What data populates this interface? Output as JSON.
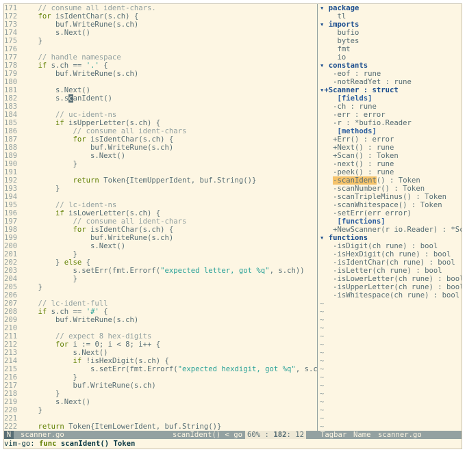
{
  "editor": {
    "lines": [
      {
        "n": "171",
        "segs": [
          [
            "cm",
            "    // consume all ident-chars."
          ]
        ]
      },
      {
        "n": "172",
        "segs": [
          [
            "",
            "    "
          ],
          [
            "kw",
            "for"
          ],
          [
            "",
            " isIdentChar(s.ch) {"
          ]
        ]
      },
      {
        "n": "173",
        "segs": [
          [
            "",
            "        buf.WriteRune(s.ch)"
          ]
        ]
      },
      {
        "n": "174",
        "segs": [
          [
            "",
            "        s.Next()"
          ]
        ]
      },
      {
        "n": "175",
        "segs": [
          [
            "",
            "    }"
          ]
        ]
      },
      {
        "n": "176",
        "segs": []
      },
      {
        "n": "177",
        "segs": [
          [
            "cm",
            "    // handle namespace"
          ]
        ]
      },
      {
        "n": "178",
        "segs": [
          [
            "",
            "    "
          ],
          [
            "kw",
            "if"
          ],
          [
            "",
            " s.ch == "
          ],
          [
            "st",
            "'.'"
          ],
          [
            "",
            " {"
          ]
        ]
      },
      {
        "n": "179",
        "segs": [
          [
            "",
            "        buf.WriteRune(s.ch)"
          ]
        ]
      },
      {
        "n": "180",
        "segs": []
      },
      {
        "n": "181",
        "segs": [
          [
            "",
            "        s.Next()"
          ]
        ]
      },
      {
        "n": "182",
        "segs": [
          [
            "",
            "        s.s"
          ],
          [
            "cursor",
            "c"
          ],
          [
            "",
            "anIdent()"
          ]
        ]
      },
      {
        "n": "183",
        "segs": []
      },
      {
        "n": "184",
        "segs": [
          [
            "cm",
            "        // uc-ident-ns"
          ]
        ]
      },
      {
        "n": "185",
        "segs": [
          [
            "",
            "        "
          ],
          [
            "kw",
            "if"
          ],
          [
            "",
            " isUpperLetter(s.ch) {"
          ]
        ]
      },
      {
        "n": "186",
        "segs": [
          [
            "cm",
            "            // consume all ident-chars"
          ]
        ]
      },
      {
        "n": "187",
        "segs": [
          [
            "",
            "            "
          ],
          [
            "kw",
            "for"
          ],
          [
            "",
            " isIdentChar(s.ch) {"
          ]
        ]
      },
      {
        "n": "188",
        "segs": [
          [
            "",
            "                buf.WriteRune(s.ch)"
          ]
        ]
      },
      {
        "n": "189",
        "segs": [
          [
            "",
            "                s.Next()"
          ]
        ]
      },
      {
        "n": "190",
        "segs": [
          [
            "",
            "            }"
          ]
        ]
      },
      {
        "n": "191",
        "segs": []
      },
      {
        "n": "192",
        "segs": [
          [
            "",
            "            "
          ],
          [
            "kw",
            "return"
          ],
          [
            "",
            " Token{ItemUpperIdent, buf.String()}"
          ]
        ]
      },
      {
        "n": "193",
        "segs": [
          [
            "",
            "        }"
          ]
        ]
      },
      {
        "n": "194",
        "segs": []
      },
      {
        "n": "195",
        "segs": [
          [
            "cm",
            "        // lc-ident-ns"
          ]
        ]
      },
      {
        "n": "196",
        "segs": [
          [
            "",
            "        "
          ],
          [
            "kw",
            "if"
          ],
          [
            "",
            " isLowerLetter(s.ch) {"
          ]
        ]
      },
      {
        "n": "197",
        "segs": [
          [
            "cm",
            "            // consume all ident-chars"
          ]
        ]
      },
      {
        "n": "198",
        "segs": [
          [
            "",
            "            "
          ],
          [
            "kw",
            "for"
          ],
          [
            "",
            " isIdentChar(s.ch) {"
          ]
        ]
      },
      {
        "n": "199",
        "segs": [
          [
            "",
            "                buf.WriteRune(s.ch)"
          ]
        ]
      },
      {
        "n": "200",
        "segs": [
          [
            "",
            "                s.Next()"
          ]
        ]
      },
      {
        "n": "201",
        "segs": [
          [
            "",
            "            }"
          ]
        ]
      },
      {
        "n": "202",
        "segs": [
          [
            "",
            "        } "
          ],
          [
            "kw",
            "else"
          ],
          [
            "",
            " {"
          ]
        ]
      },
      {
        "n": "203",
        "segs": [
          [
            "",
            "            s.setErr(fmt.Errorf("
          ],
          [
            "st",
            "\"expected letter, got %q\""
          ],
          [
            "",
            ", s.ch))"
          ]
        ]
      },
      {
        "n": "204",
        "segs": [
          [
            "",
            "            }"
          ]
        ]
      },
      {
        "n": "205",
        "segs": [
          [
            "",
            "    }"
          ]
        ]
      },
      {
        "n": "206",
        "segs": []
      },
      {
        "n": "207",
        "segs": [
          [
            "cm",
            "    // lc-ident-full"
          ]
        ]
      },
      {
        "n": "208",
        "segs": [
          [
            "",
            "    "
          ],
          [
            "kw",
            "if"
          ],
          [
            "",
            " s.ch == "
          ],
          [
            "st",
            "'#'"
          ],
          [
            "",
            " {"
          ]
        ]
      },
      {
        "n": "209",
        "segs": [
          [
            "",
            "        buf.WriteRune(s.ch)"
          ]
        ]
      },
      {
        "n": "210",
        "segs": []
      },
      {
        "n": "211",
        "segs": [
          [
            "cm",
            "        // expect 8 hex-digits"
          ]
        ]
      },
      {
        "n": "212",
        "segs": [
          [
            "",
            "        "
          ],
          [
            "kw",
            "for"
          ],
          [
            "",
            " i := 0; i < 8; i++ {"
          ]
        ]
      },
      {
        "n": "213",
        "segs": [
          [
            "",
            "            s.Next()"
          ]
        ]
      },
      {
        "n": "214",
        "segs": [
          [
            "",
            "            "
          ],
          [
            "kw",
            "if"
          ],
          [
            "",
            " !isHexDigit(s.ch) {"
          ]
        ]
      },
      {
        "n": "215",
        "segs": [
          [
            "",
            "                s.setErr(fmt.Errorf("
          ],
          [
            "st",
            "\"expected hexdigit, got %q\""
          ],
          [
            "",
            ", s.ch))"
          ]
        ]
      },
      {
        "n": "216",
        "segs": [
          [
            "",
            "            }"
          ]
        ]
      },
      {
        "n": "217",
        "segs": [
          [
            "",
            "            buf.WriteRune(s.ch)"
          ]
        ]
      },
      {
        "n": "218",
        "segs": [
          [
            "",
            "        }"
          ]
        ]
      },
      {
        "n": "219",
        "segs": [
          [
            "",
            "        s.Next()"
          ]
        ]
      },
      {
        "n": "220",
        "segs": [
          [
            "",
            "    }"
          ]
        ]
      },
      {
        "n": "221",
        "segs": []
      },
      {
        "n": "222",
        "segs": [
          [
            "",
            "    "
          ],
          [
            "kw",
            "return"
          ],
          [
            "",
            " Token{ItemLowerIdent, buf.String()}"
          ]
        ]
      }
    ]
  },
  "tagbar": {
    "lines": [
      {
        "t": "▾ package",
        "k": "head"
      },
      {
        "t": "    tl"
      },
      {
        "t": "▾ imports",
        "k": "head"
      },
      {
        "t": "    bufio"
      },
      {
        "t": "    bytes"
      },
      {
        "t": "    fmt"
      },
      {
        "t": "    io"
      },
      {
        "t": "▾ constants",
        "k": "head"
      },
      {
        "t": "   -eof : rune"
      },
      {
        "t": "   -notReadYet : rune"
      },
      {
        "t": "▾+Scanner : struct",
        "k": "head"
      },
      {
        "t": "    [fields]",
        "k": "sub"
      },
      {
        "t": "   -ch : rune"
      },
      {
        "t": "   -err : error"
      },
      {
        "t": "   -r : *bufio.Reader"
      },
      {
        "t": "    [methods]",
        "k": "sub"
      },
      {
        "t": "   +Err() : error"
      },
      {
        "t": "   +Next() : rune"
      },
      {
        "t": "   +Scan() : Token"
      },
      {
        "t": "   -next() : rune"
      },
      {
        "t": "   -peek() : rune"
      },
      {
        "t": "   -scanIdent() : Token",
        "k": "hl",
        "hl": "-scanIdent"
      },
      {
        "t": "   -scanNumber() : Token"
      },
      {
        "t": "   -scanTripleMinus() : Token"
      },
      {
        "t": "   -scanWhitespace() : Token"
      },
      {
        "t": "   -setErr(err error)"
      },
      {
        "t": "    [functions]",
        "k": "sub"
      },
      {
        "t": "   +NewScanner(r io.Reader) : *Sca>"
      },
      {
        "t": "▾ functions",
        "k": "head"
      },
      {
        "t": "   -isDigit(ch rune) : bool"
      },
      {
        "t": "   -isHexDigit(ch rune) : bool"
      },
      {
        "t": "   -isIdentChar(ch rune) : bool"
      },
      {
        "t": "   -isLetter(ch rune) : bool"
      },
      {
        "t": "   -isLowerLetter(ch rune) : bool"
      },
      {
        "t": "   -isUpperLetter(ch rune) : bool"
      },
      {
        "t": "   -isWhitespace(ch rune) : bool"
      }
    ],
    "tilde_count": 16,
    "tilde": "~"
  },
  "status": {
    "mode": "N",
    "filename": "scanner.go",
    "tag": "scanIdent() < go",
    "percent": "60%",
    "sep": ":",
    "line": "182",
    "col": "12",
    "tagbar_label": "Tagbar",
    "tagbar_sort": "Name",
    "tagbar_file": "scanner.go"
  },
  "cmdline": {
    "prefix": "vim-go: ",
    "keyword": "func",
    "rest": " scanIdent() Token"
  },
  "colors": {
    "background": "#fdf6e3",
    "keyword": "#5f7f00",
    "comment": "#93a1a1",
    "string": "#2aa198",
    "highlight": "#f5c36b"
  }
}
